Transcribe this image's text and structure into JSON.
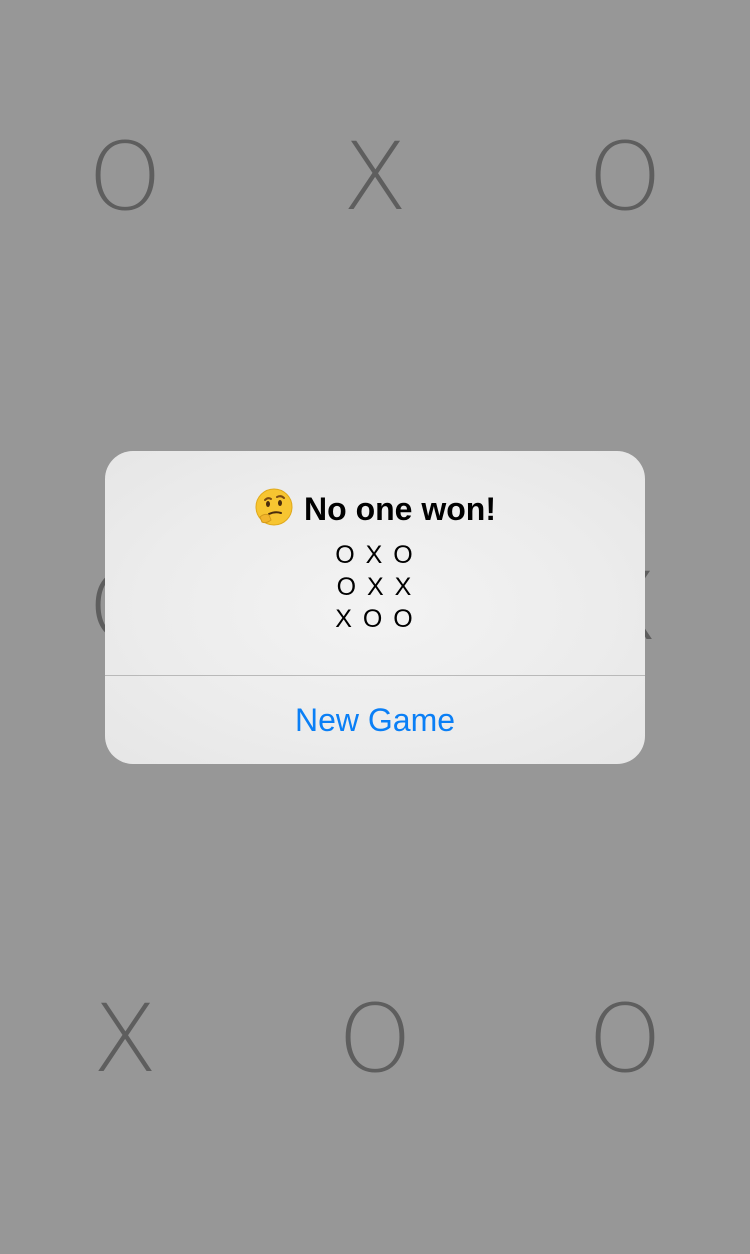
{
  "board": {
    "cells": [
      [
        "O",
        "X",
        "O"
      ],
      [
        "O",
        "",
        "X"
      ],
      [
        "X",
        "O",
        "O"
      ]
    ]
  },
  "alert": {
    "emoji": "thinking-face-icon",
    "title": "No one won!",
    "message_lines": [
      "O X O",
      "O X X",
      "X O O"
    ],
    "action_label": "New Game"
  },
  "colors": {
    "background": "#979797",
    "mark": "#5e5e5e",
    "alert_bg": "#ececec",
    "action": "#0a7ff6"
  }
}
